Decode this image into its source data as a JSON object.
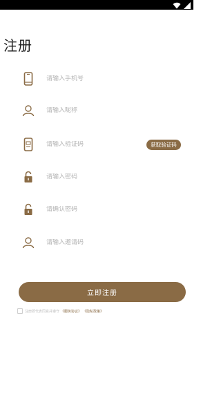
{
  "colors": {
    "accent": "#8a6b45",
    "icon": "#8a6b45",
    "placeholder": "#b4b4b4"
  },
  "status_bar": {
    "icons": [
      "wifi-icon",
      "signal-icon"
    ]
  },
  "page": {
    "title": "注册"
  },
  "form": {
    "phone": {
      "placeholder": "请输入手机号",
      "value": "",
      "icon": "phone-icon"
    },
    "nickname": {
      "placeholder": "请输入昵称",
      "value": "",
      "icon": "user-icon"
    },
    "code": {
      "placeholder": "请输入验证码",
      "value": "",
      "icon": "sms-icon",
      "button_label": "获取验证码"
    },
    "password": {
      "placeholder": "请输入密码",
      "value": "",
      "icon": "lock-icon"
    },
    "confirm_password": {
      "placeholder": "请确认密码",
      "value": "",
      "icon": "lock-icon"
    },
    "invite": {
      "placeholder": "请输入邀请码",
      "value": "",
      "icon": "user-icon"
    }
  },
  "submit": {
    "label": "立即注册"
  },
  "agreement": {
    "checked": false,
    "text": "注册即代表同意并遵守",
    "user_agreement": "《服务协议》",
    "privacy_policy": "《隐私政策》"
  }
}
